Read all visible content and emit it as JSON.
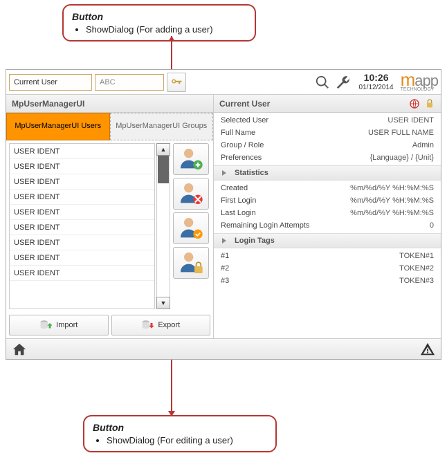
{
  "callout_top": {
    "title": "Button",
    "text": "ShowDialog  (For adding a user)"
  },
  "callout_bottom": {
    "title": "Button",
    "text": "ShowDialog  (For editing a user)"
  },
  "topbar": {
    "current_user_label": "Current User",
    "abc_placeholder": "ABC",
    "time": "10:26",
    "date": "01/12/2014",
    "logo_main": "mapp",
    "logo_sub": "TECHNOLOGY"
  },
  "left_title": "MpUserManagerUI",
  "right_title": "Current User",
  "tabs": {
    "users": "MpUserManagerUI Users",
    "groups": "MpUserManagerUI Groups"
  },
  "user_rows": [
    "USER IDENT",
    "USER IDENT",
    "USER IDENT",
    "USER IDENT",
    "USER IDENT",
    "USER IDENT",
    "USER IDENT",
    "USER IDENT",
    "USER IDENT"
  ],
  "import_label": "Import",
  "export_label": "Export",
  "details": {
    "selected_user_k": "Selected User",
    "selected_user_v": "USER IDENT",
    "full_name_k": "Full Name",
    "full_name_v": "USER FULL NAME",
    "group_k": "Group / Role",
    "group_v": "Admin",
    "prefs_k": "Preferences",
    "prefs_v": "{Language} / {Unit}"
  },
  "stats_head": "Statistics",
  "stats": {
    "created_k": "Created",
    "created_v": "%m/%d/%Y %H:%M:%S",
    "first_k": "First Login",
    "first_v": "%m/%d/%Y %H:%M:%S",
    "last_k": "Last Login",
    "last_v": "%m/%d/%Y %H:%M:%S",
    "remain_k": "Remaining Login Attempts",
    "remain_v": "0"
  },
  "tags_head": "Login Tags",
  "tags": {
    "t1k": "#1",
    "t1v": "TOKEN#1",
    "t2k": "#2",
    "t2v": "TOKEN#2",
    "t3k": "#3",
    "t3v": "TOKEN#3"
  }
}
